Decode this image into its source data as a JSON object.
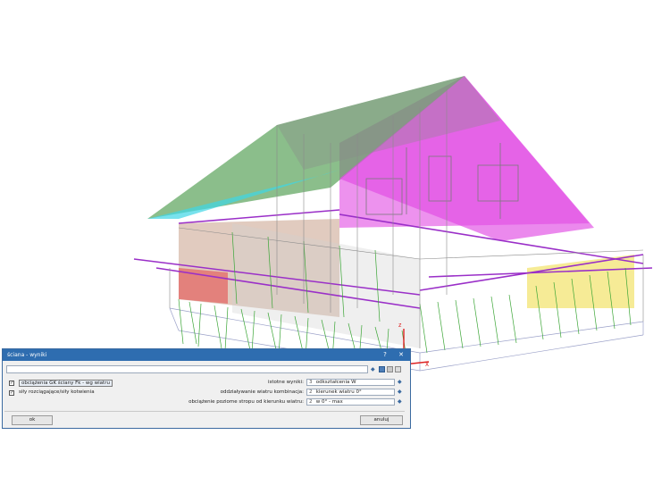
{
  "dialog": {
    "title": "ściana - wyniki",
    "help_label": "?",
    "close_label": "✕",
    "search_value": "",
    "options": [
      {
        "label": "obciążenia GK ściany Fk - wg wiatru",
        "checked": true
      },
      {
        "label": "siły rozciągające/siły kotwienia",
        "checked": true
      }
    ],
    "fields": [
      {
        "label": "istotne wyniki:",
        "number": "3",
        "value": "odkształcenia W"
      },
      {
        "label": "oddziaływanie wiatru kombinacja:",
        "number": "2",
        "value": "kierunek wiatru 0°"
      },
      {
        "label": "obciążenie poziome stropu od kierunku wiatru:",
        "number": "2",
        "value": "w 0° - max"
      }
    ],
    "ok_label": "ok",
    "cancel_label": "anuluj"
  },
  "axis": {
    "z": "z",
    "x": "x"
  },
  "colors": {
    "titlebar": "#2e6db0",
    "roof_left": "#5aa35a",
    "roof_right": "#e14ae3",
    "wall_red": "#e64646",
    "wall_yellow": "#f2e36a",
    "cyan": "#3fd6e6",
    "studs": "#3aa535",
    "beams": "#9a2fc8"
  },
  "icons": [
    "pin-icon",
    "save-icon",
    "copy-icon",
    "delete-icon",
    "dropdown-arrow-icon"
  ]
}
